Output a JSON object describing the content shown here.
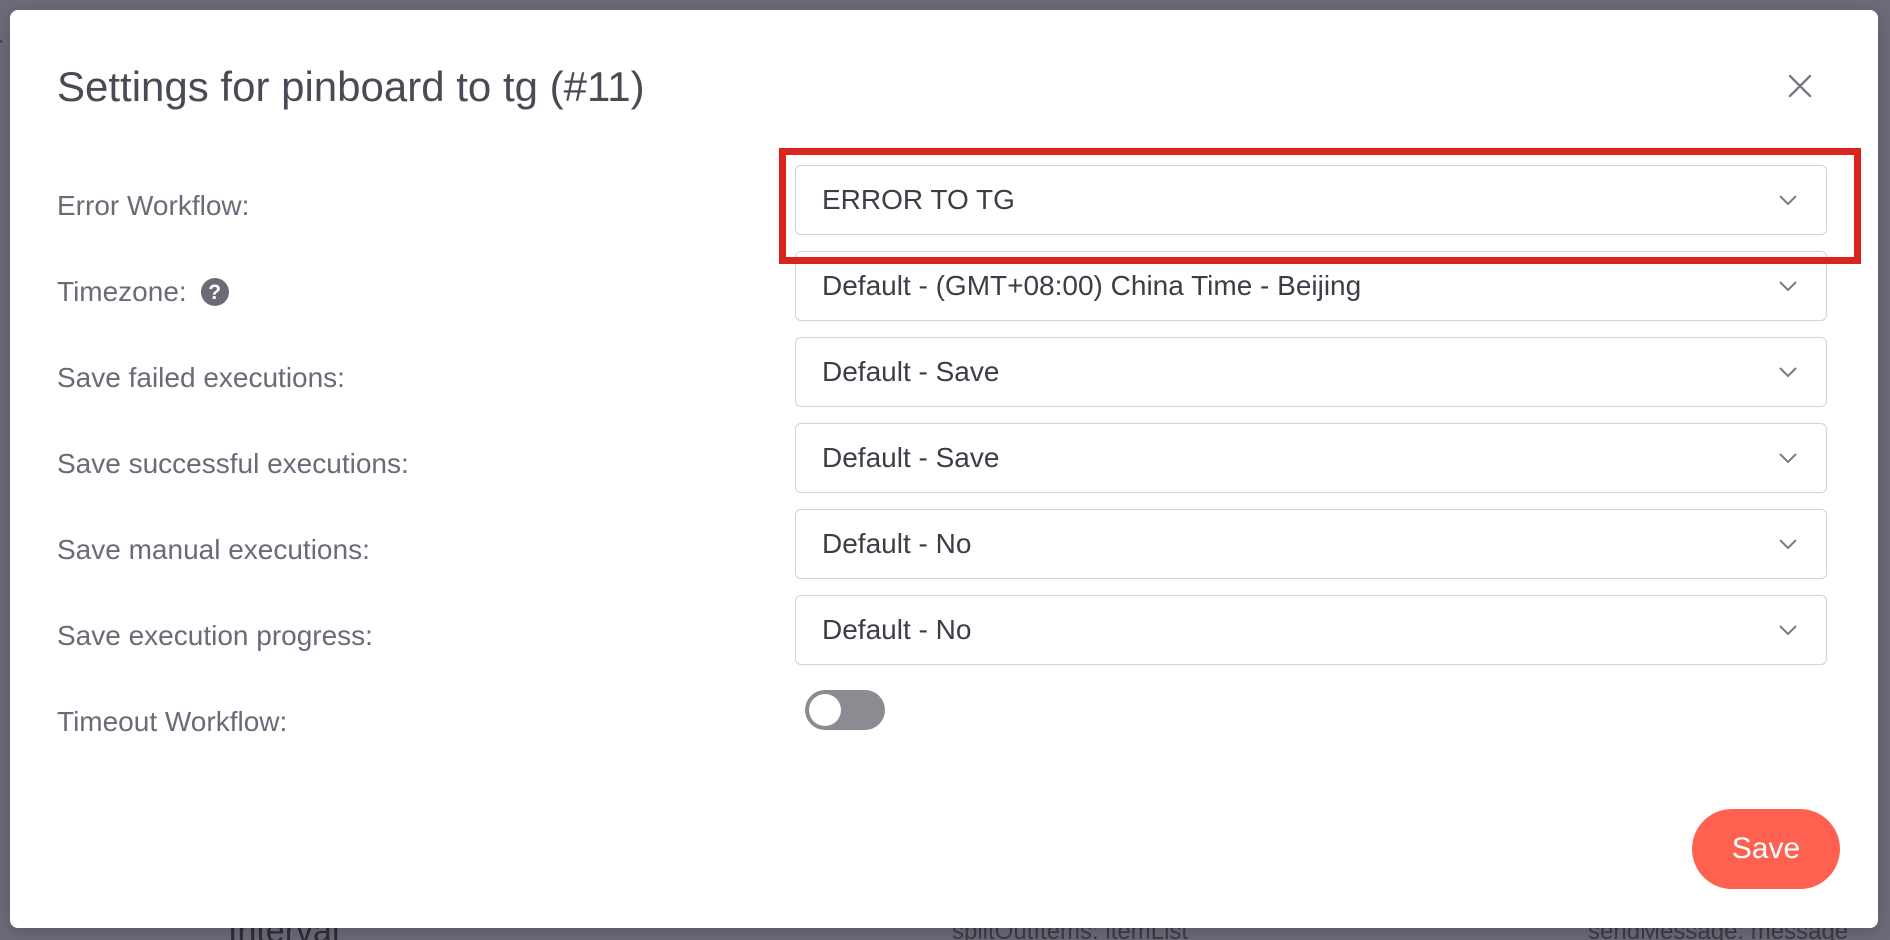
{
  "modal": {
    "title": "Settings for pinboard to tg (#11)",
    "save_label": "Save"
  },
  "settings": [
    {
      "label": "Error Workflow:",
      "value": "ERROR TO TG"
    },
    {
      "label": "Timezone:",
      "value": "Default - (GMT+08:00) China Time - Beijing"
    },
    {
      "label": "Save failed executions:",
      "value": "Default - Save"
    },
    {
      "label": "Save successful executions:",
      "value": "Default - Save"
    },
    {
      "label": "Save manual executions:",
      "value": "Default - No"
    },
    {
      "label": "Save execution progress:",
      "value": "Default - No"
    },
    {
      "label": "Timeout Workflow:",
      "enabled": false
    }
  ],
  "background": {
    "edge_char": "r",
    "node_title": "Interval",
    "node_param_1": "splitOutItems: itemList",
    "node_param_2": "sendMessage: message"
  },
  "colors": {
    "accent": "#ff6150",
    "highlight": "#d9251d",
    "toggle_off": "#8b8b92",
    "label_text": "#6b6b78"
  },
  "icons": {
    "close": "close-icon",
    "help": "question-circle-icon",
    "dropdown": "chevron-down-icon"
  }
}
